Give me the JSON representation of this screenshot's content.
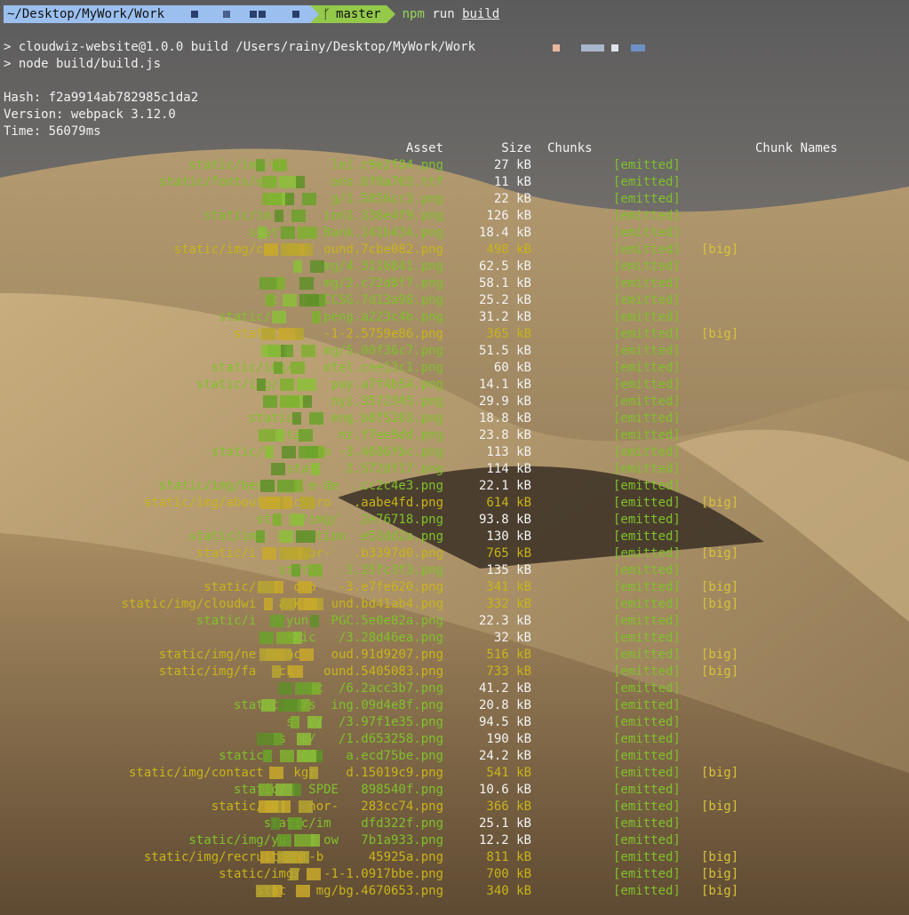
{
  "prompt": {
    "path": "~/Desktop/MyWork/Work",
    "branch": "master",
    "command_npm": "npm",
    "command_run": " run ",
    "command_build": "build"
  },
  "output_lines": [
    "> cloudwiz-website@1.0.0 build /Users/rainy/Desktop/MyWork/Work",
    "> node build/build.js"
  ],
  "stats": {
    "hash": "Hash: f2a9914ab782985c1da2",
    "version": "Version: webpack 3.12.0",
    "time": "Time: 56079ms"
  },
  "table_headers": {
    "asset": "Asset",
    "size": "Size",
    "chunks": "Chunks",
    "chunk_names": "Chunk Names"
  },
  "status_label": "[emitted]",
  "big_label": "[big]",
  "rows": [
    {
      "asset": "static/img/wa      lei.c9e2f84.png",
      "size": "27 kB",
      "big": false
    },
    {
      "asset": "static/fonts/elem      ons.6f0a763.ttf",
      "size": "11 kB",
      "big": false
    },
    {
      "asset": "sta     g/1.5856cc3.png",
      "size": "22 kB",
      "big": false
    },
    {
      "asset": "static/im       ion1.336e4f9.png",
      "size": "126 kB",
      "big": false
    },
    {
      "asset": "stat      Bank.141b434.png",
      "size": "18.4 kB",
      "big": false
    },
    {
      "asset": "static/img/cas      ound.7cbe082.png",
      "size": "498 kB",
      "big": true
    },
    {
      "asset": "mg/4.3116841.png",
      "size": "62.5 kB",
      "big": false
    },
    {
      "asset": "mg/2.c72d8f7.png",
      "size": "58.1 kB",
      "big": false
    },
    {
      "asset": "st      CCSG.7d13a98.png",
      "size": "25.2 kB",
      "big": false
    },
    {
      "asset": "static/       peng.a223c4b.png",
      "size": "31.2 kB",
      "big": false
    },
    {
      "asset": "static/     -1-2.5759e86.png",
      "size": "365 kB",
      "big": true
    },
    {
      "asset": "mg/5.00f36c7.png",
      "size": "51.5 kB",
      "big": false
    },
    {
      "asset": "static/img/    otel.cee13c1.png",
      "size": "60 kB",
      "big": false
    },
    {
      "asset": "static/img/ch     pay.a7f4b54.png",
      "size": "14.1 kB",
      "big": false
    },
    {
      "asset": "stat     nyi.3572345.png",
      "size": "29.9 kB",
      "big": false
    },
    {
      "asset": "static     eng.b8f5283.png",
      "size": "18.8 kB",
      "big": false
    },
    {
      "asset": "sta     nz.f7ee9dd.png",
      "size": "23.8 kB",
      "big": false
    },
    {
      "asset": "static/i     ono -3.4606fbc.png",
      "size": "113 kB",
      "big": false
    },
    {
      "asset": "stat    2.572df17.png",
      "size": "114 kB",
      "big": false
    },
    {
      "asset": "static/img/benz-    e-de  .cc2c4e3.png",
      "size": "22.1 kB",
      "big": false
    },
    {
      "asset": "static/img/about    ckgro   .aabe4fd.png",
      "size": "614 kB",
      "big": true
    },
    {
      "asset": "sta   /img/   2e76718.png",
      "size": "93.8 kB",
      "big": false
    },
    {
      "asset": "static/img    ibition  e53dd2a.png",
      "size": "130 kB",
      "big": false
    },
    {
      "asset": "static/i    honor-   .b3397d0.png",
      "size": "765 kB",
      "big": true
    },
    {
      "asset": "stati    1.25fc3f3.png",
      "size": "135 kB",
      "big": false
    },
    {
      "asset": "static/i    ono   -3.e7fe620.png",
      "size": "341 kB",
      "big": true
    },
    {
      "asset": "static/img/cloudwi   ack    und.bd41ab4.png",
      "size": "332 kB",
      "big": true
    },
    {
      "asset": "static/i    yun   PGC.5e0e82a.png",
      "size": "22.3 kB",
      "big": false
    },
    {
      "asset": "stic   /3.28d46ea.png",
      "size": "32 kB",
      "big": false
    },
    {
      "asset": "static/img/ne    ac    oud.91d9207.png",
      "size": "516 kB",
      "big": true
    },
    {
      "asset": "static/img/fa   ck    ound.5405083.png",
      "size": "733 kB",
      "big": true
    },
    {
      "asset": "ic  /6.2acc3b7.png",
      "size": "41.2 kB",
      "big": false
    },
    {
      "asset": "static,  /s  ing.09d4e8f.png",
      "size": "20.8 kB",
      "big": false
    },
    {
      "asset": "s  c/  /3.97f1e35.png",
      "size": "94.5 kB",
      "big": false
    },
    {
      "asset": "s  c/   /1.d653258.png",
      "size": "190 kB",
      "big": false
    },
    {
      "asset": "static/    gua   a.ecd75be.png",
      "size": "24.2 kB",
      "big": false
    },
    {
      "asset": "static/img/contact    kgr    d.15019c9.png",
      "size": "541 kB",
      "big": true
    },
    {
      "asset": "static/   SPDE   898540f.png",
      "size": "10.6 kB",
      "big": false
    },
    {
      "asset": "static/im    nor-   283cc74.png",
      "size": "366 kB",
      "big": true
    },
    {
      "asset": "static/im    dfd322f.png",
      "size": "25.1 kB",
      "big": false
    },
    {
      "asset": "static/img/yu     ow   7b1a933.png",
      "size": "12.2 kB",
      "big": false
    },
    {
      "asset": "static/img/recruitment-b      45925a.png",
      "size": "811 kB",
      "big": true
    },
    {
      "asset": "static/img/   -1-1.0917bbe.png",
      "size": "700 kB",
      "big": true
    },
    {
      "asset": "stat    mg/bg.4670653.png",
      "size": "340 kB",
      "big": true
    }
  ]
}
